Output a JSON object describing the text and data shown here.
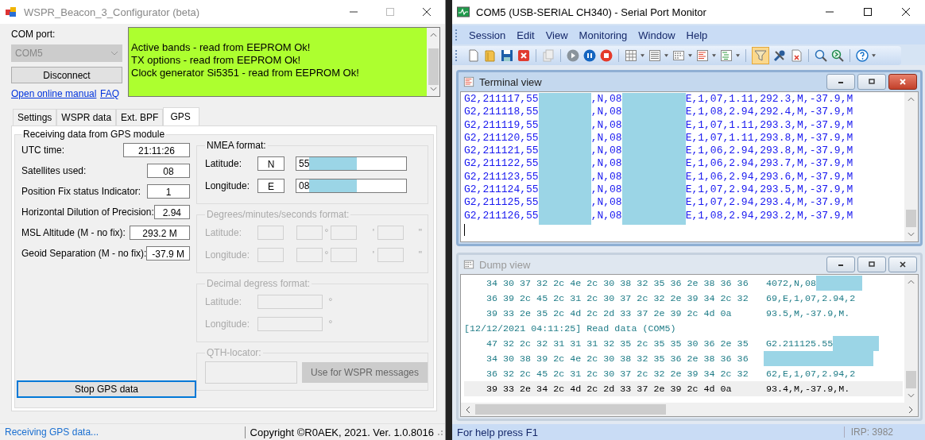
{
  "left_window": {
    "title": "WSPR_Beacon_3_Configurator (beta)",
    "com_port": {
      "label": "COM port:",
      "value": "COM5",
      "disabled": true
    },
    "connect_button": "Disconnect",
    "links": [
      "Open online manual",
      "FAQ"
    ],
    "log": [
      "Active bands - read from EEPROM Ok!",
      "TX options - read from EEPROM Ok!",
      "Clock generator Si5351 - read from EEPROM Ok!"
    ],
    "tabs": [
      {
        "label": "Settings",
        "selected": false
      },
      {
        "label": "WSPR data",
        "selected": false
      },
      {
        "label": "Ext. BPF",
        "selected": false
      },
      {
        "label": "GPS",
        "selected": true
      }
    ],
    "gps": {
      "title": "Receiving data from GPS module",
      "readings": [
        {
          "label": "UTC time:",
          "value": "21:11:26"
        },
        {
          "label": "Satellites used:",
          "value": "08"
        },
        {
          "label": "Position Fix status Indicator:",
          "value": "1"
        },
        {
          "label": "Horizontal Dilution of Precision:",
          "value": "2.94"
        },
        {
          "label": "MSL Altitude (M - no fix):",
          "value": "293.2 M"
        },
        {
          "label": "Geoid Separation (M - no fix):",
          "value": "-37.9 M"
        }
      ],
      "stop_button": "Stop GPS data",
      "nmea": {
        "title": "NMEA format:",
        "disabled": false,
        "rows": [
          {
            "label": "Latitude:",
            "hemisphere": "N",
            "value": "55"
          },
          {
            "label": "Longitude:",
            "hemisphere": "E",
            "value": "08"
          }
        ]
      },
      "dms": {
        "title": "Degrees/minutes/seconds format:",
        "disabled": true,
        "rows": [
          {
            "label": "Latitude:",
            "units": [
              "°",
              "'",
              "\""
            ]
          },
          {
            "label": "Longitude:",
            "units": [
              "°",
              "'",
              "\""
            ]
          }
        ]
      },
      "decimal": {
        "title": "Decimal degress format:",
        "disabled": true,
        "rows": [
          {
            "label": "Latitude:",
            "units": [
              "°"
            ]
          },
          {
            "label": "Longitude:",
            "units": [
              "°"
            ]
          }
        ]
      },
      "qth": {
        "title": "QTH-locator:",
        "disabled": true,
        "button": "Use for WSPR messages"
      }
    },
    "status_bar": {
      "message": "Receiving GPS data...",
      "copyright": "Copyright ©R0AEK, 2021. Ver. 1.0.8016"
    }
  },
  "right_window": {
    "title": "COM5 (USB-SERIAL CH340) - Serial Port Monitor",
    "menu": [
      "Session",
      "Edit",
      "View",
      "Monitoring",
      "Window",
      "Help"
    ],
    "toolbar": {
      "filter_active": true
    },
    "terminal": {
      "title": "Terminal view",
      "active": true,
      "lines": [
        {
          "head": "G2,211117,55",
          "middle": ",N,08",
          "tail": "E,1,07,1.11,292.3,M,-37.9,M"
        },
        {
          "head": "G2,211118,55",
          "middle": ",N,08",
          "tail": "E,1,08,2.94,292.4,M,-37.9,M"
        },
        {
          "head": "G2,211119,55",
          "middle": ",N,08",
          "tail": "E,1,07,1.11,293.3,M,-37.9,M"
        },
        {
          "head": "G2,211120,55",
          "middle": ",N,08",
          "tail": "E,1,07,1.11,293.8,M,-37.9,M"
        },
        {
          "head": "G2,211121,55",
          "middle": ",N,08",
          "tail": "E,1,06,2.94,293.8,M,-37.9,M"
        },
        {
          "head": "G2,211122,55",
          "middle": ",N,08",
          "tail": "E,1,06,2.94,293.7,M,-37.9,M"
        },
        {
          "head": "G2,211123,55",
          "middle": ",N,08",
          "tail": "E,1,06,2.94,293.6,M,-37.9,M"
        },
        {
          "head": "G2,211124,55",
          "middle": ",N,08",
          "tail": "E,1,07,2.94,293.5,M,-37.9,M"
        },
        {
          "head": "G2,211125,55",
          "middle": ",N,08",
          "tail": "E,1,07,2.94,293.4,M,-37.9,M"
        },
        {
          "head": "G2,211126,55",
          "middle": ",N,08",
          "tail": "E,1,08,2.94,293.2,M,-37.9,M"
        }
      ]
    },
    "dump": {
      "title": "Dump view",
      "active": false,
      "rows": [
        {
          "kind": "data",
          "hex": "34 30 37 32 2c 4e 2c 30 38 32 35 36 2e 38 36 36",
          "ascii": "4072,N,08",
          "redacted": true,
          "selected": false
        },
        {
          "kind": "data",
          "hex": "36 39 2c 45 2c 31 2c 30 37 2c 32 2e 39 34 2c 32",
          "ascii": "69,E,1,07,2.94,2",
          "redacted": false,
          "selected": false
        },
        {
          "kind": "data",
          "hex": "39 33 2e 35 2c 4d 2c 2d 33 37 2e 39 2c 4d 0a",
          "ascii": "93.5,M,-37.9,M.",
          "redacted": false,
          "selected": false
        },
        {
          "kind": "header",
          "text": "[12/12/2021 04:11:25] Read data (COM5)"
        },
        {
          "kind": "data",
          "hex": "47 32 2c 32 31 31 31 32 35 2c 35 35 30 36 2e 35",
          "ascii": "G2.211125.55",
          "redacted": true,
          "selected": false
        },
        {
          "kind": "data",
          "hex": "34 30 38 39 2c 4e 2c 30 38 32 35 36 2e 38 36 36",
          "redacted": true,
          "selected": false
        },
        {
          "kind": "data",
          "hex": "36 32 2c 45 2c 31 2c 30 37 2c 32 2e 39 34 2c 32",
          "ascii": "62,E,1,07,2.94,2",
          "redacted": false,
          "selected": false
        },
        {
          "kind": "data",
          "hex": "39 33 2e 34 2c 4d 2c 2d 33 37 2e 39 2c 4d 0a",
          "ascii": "93.4,M,-37.9,M.",
          "redacted": false,
          "selected": true
        }
      ]
    },
    "status_bar": {
      "help": "For help press F1",
      "irp": "IRP: 3982"
    }
  }
}
